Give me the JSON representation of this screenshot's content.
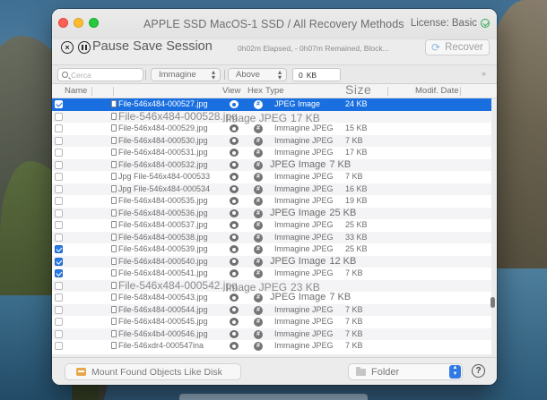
{
  "window": {
    "title": "APPLE SSD MacOS-1 SSD / All Recovery Methods",
    "license": "License: Basic"
  },
  "toolbar": {
    "session_label": "Pause Save Session",
    "elapsed": "0h02m Elapsed, - 0h07m Remained, Block...",
    "recover_label": "Recover"
  },
  "filters": {
    "search_placeholder": "Cerca",
    "type_value": "Immagine",
    "compare_value": "Above",
    "size_value": "0",
    "size_unit": "KB"
  },
  "columns": {
    "name": "Name",
    "view": "View",
    "hex": "Hex",
    "type": "Type",
    "size": "Size",
    "modified": "Modif. Date"
  },
  "rows": [
    {
      "checked": true,
      "selected": true,
      "name": "File-546x484-000527.jpg",
      "type": "JPEG Image",
      "size": "24 KB"
    },
    {
      "checked": false,
      "selected": false,
      "big": true,
      "name": "File-546x484-000528.jpg",
      "type": "Image JPEG",
      "size": "17 KB"
    },
    {
      "checked": false,
      "selected": false,
      "name": "File-546x484-000529.jpg",
      "type": "Immagine JPEG",
      "size": "15 KB"
    },
    {
      "checked": false,
      "selected": false,
      "name": "File-546x484-000530.jpg",
      "type": "Immagine JPEG",
      "size": "7 KB"
    },
    {
      "checked": false,
      "selected": false,
      "name": "File-546x484-000531.jpg",
      "type": "Immagine JPEG",
      "size": "17 KB"
    },
    {
      "checked": false,
      "selected": false,
      "merged": true,
      "name": "File-546x484-000532.jpg",
      "type": "JPEG Image",
      "size": "7 KB"
    },
    {
      "checked": false,
      "selected": false,
      "name": "Jpg File-546x484-000533",
      "type": "Immagine JPEG",
      "size": "7 KB"
    },
    {
      "checked": false,
      "selected": false,
      "name": "Jpg File-546x484-000534",
      "type": "Immagine JPEG",
      "size": "16 KB"
    },
    {
      "checked": false,
      "selected": false,
      "name": "File-546x484-000535.jpg",
      "type": "Immagine JPEG",
      "size": "19 KB"
    },
    {
      "checked": false,
      "selected": false,
      "merged": true,
      "name": "File-546x484-000536.jpg",
      "type": "JPEG Image",
      "size": "25 KB"
    },
    {
      "checked": false,
      "selected": false,
      "name": "File-546x484-000537.jpg",
      "type": "Immagine JPEG",
      "size": "25 KB"
    },
    {
      "checked": false,
      "selected": false,
      "name": "File-546x484-000538.jpg",
      "type": "Immagine JPEG",
      "size": "33 KB"
    },
    {
      "checked": true,
      "selected": false,
      "name": "File-546x484-000539.jpg",
      "type": "Immagine JPEG",
      "size": "25 KB"
    },
    {
      "checked": true,
      "selected": false,
      "merged": true,
      "name": "File-546x484-000540.jpg",
      "type": "JPEG Image",
      "size": "12 KB"
    },
    {
      "checked": true,
      "selected": false,
      "name": "File-546x484-000541.jpg",
      "type": "Immagine JPEG",
      "size": "7 KB"
    },
    {
      "checked": false,
      "selected": false,
      "big": true,
      "name": "File-546x484-000542.jpg",
      "type": "Image JPEG",
      "size": "23 KB"
    },
    {
      "checked": false,
      "selected": false,
      "merged": true,
      "name": "File-548x484-000543.jpg",
      "type": "JPEG Image",
      "size": "7 KB"
    },
    {
      "checked": false,
      "selected": false,
      "name": "File-546x484-000544.jpg",
      "type": "Immagine JPEG",
      "size": "7 KB"
    },
    {
      "checked": false,
      "selected": false,
      "name": "File-546x484-000545.jpg",
      "type": "Immagine JPEG",
      "size": "7 KB"
    },
    {
      "checked": false,
      "selected": false,
      "name": "File-546x4b4-000546.jpg",
      "type": "Immagine JPEG",
      "size": "7 KB"
    },
    {
      "checked": false,
      "selected": false,
      "name": "File-546xdr4-000547ina",
      "type": "Immagine JPEG",
      "size": "7 KB"
    }
  ],
  "bottom": {
    "mount_label": "Mount Found Objects Like Disk",
    "destination_value": "Folder",
    "help_label": "?"
  },
  "colors": {
    "selection": "#1a6fe0",
    "accent": "#2f7ae5"
  }
}
